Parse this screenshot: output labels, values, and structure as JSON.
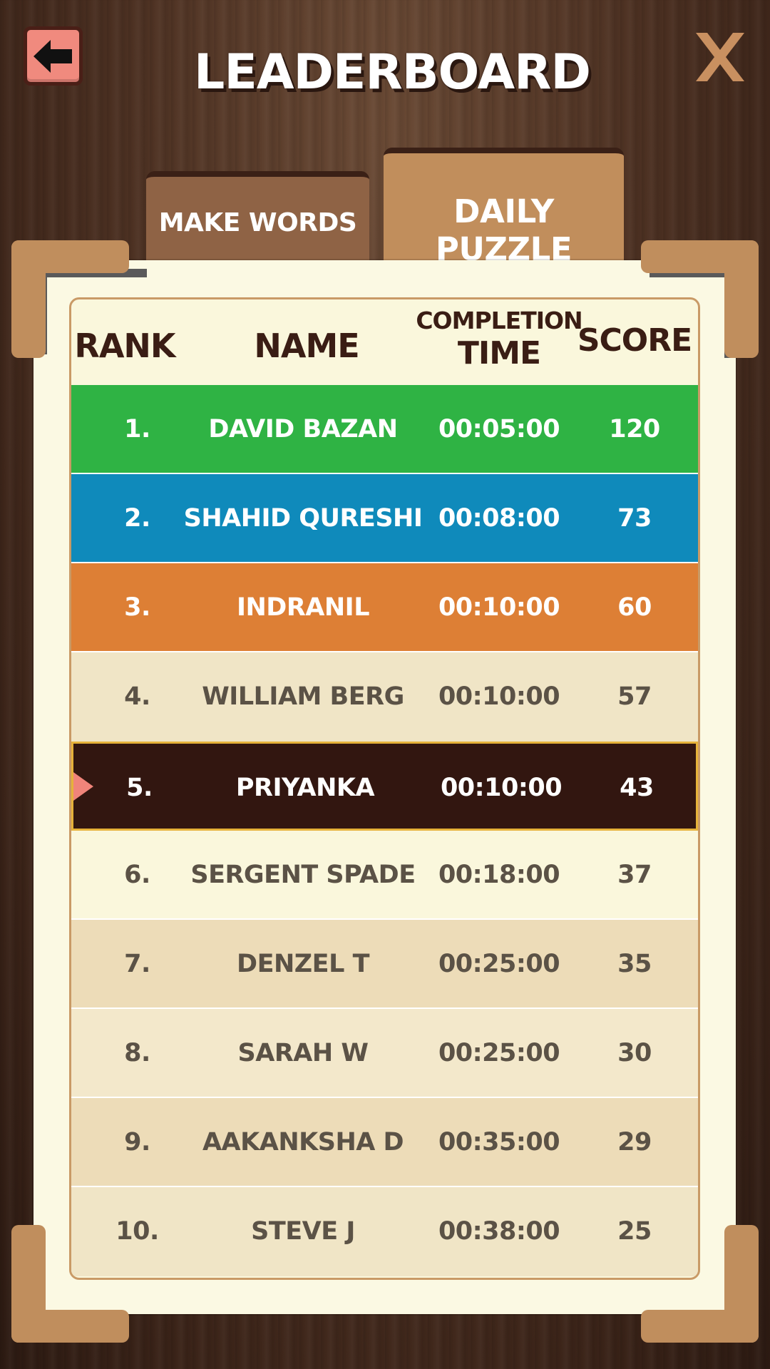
{
  "header": {
    "title": "LEADERBOARD",
    "back_icon": "arrow-left-icon",
    "close_icon": "close-x-icon"
  },
  "tabs": [
    {
      "label": "MAKE WORDS",
      "active": false
    },
    {
      "label": "DAILY PUZZLE",
      "active": true
    }
  ],
  "table": {
    "headers": {
      "rank": "RANK",
      "name": "NAME",
      "time_top": "COMPLETION",
      "time_bottom": "TIME",
      "score": "SCORE"
    },
    "rows": [
      {
        "rank": "1.",
        "name": "DAVID BAZAN",
        "time": "00:05:00",
        "score": "120",
        "bg": "#2fb344",
        "fg": "#ffffff"
      },
      {
        "rank": "2.",
        "name": "SHAHID QURESHI",
        "time": "00:08:00",
        "score": "73",
        "bg": "#0f8abb",
        "fg": "#ffffff"
      },
      {
        "rank": "3.",
        "name": "INDRANIL",
        "time": "00:10:00",
        "score": "60",
        "bg": "#dd7f35",
        "fg": "#ffffff"
      },
      {
        "rank": "4.",
        "name": "WILLIAM BERG",
        "time": "00:10:00",
        "score": "57",
        "bg": "#f0e5c6",
        "fg": "#5b5246"
      },
      {
        "rank": "5.",
        "name": "PRIYANKA",
        "time": "00:10:00",
        "score": "43",
        "bg": "#321610",
        "fg": "#ffffff",
        "current_player": true
      },
      {
        "rank": "6.",
        "name": "SERGENT SPADE",
        "time": "00:18:00",
        "score": "37",
        "bg": "#faf7dc",
        "fg": "#5b5246"
      },
      {
        "rank": "7.",
        "name": "DENZEL T",
        "time": "00:25:00",
        "score": "35",
        "bg": "#eddcb8",
        "fg": "#5b5246"
      },
      {
        "rank": "8.",
        "name": "SARAH W",
        "time": "00:25:00",
        "score": "30",
        "bg": "#f3e8cb",
        "fg": "#5b5246"
      },
      {
        "rank": "9.",
        "name": "AAKANKSHA D",
        "time": "00:35:00",
        "score": "29",
        "bg": "#eddcb8",
        "fg": "#5b5246"
      },
      {
        "rank": "10.",
        "name": "STEVE J",
        "time": "00:38:00",
        "score": "25",
        "bg": "#f0e5c6",
        "fg": "#5b5246"
      }
    ]
  },
  "colors": {
    "frame_corner": "#c08e5d",
    "panel": "#fbf9e3",
    "highlight_border": "#e6b23a",
    "marker": "#f0847a"
  }
}
